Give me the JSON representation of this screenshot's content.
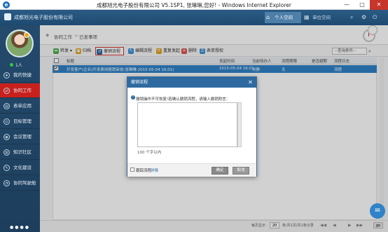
{
  "window": {
    "title": "成都旭光电子股份有限公司 V5.1SP1, 张琳琳,您好! - Windows Internet Explorer",
    "min": "—",
    "max": "□",
    "close": "✕"
  },
  "header": {
    "company": "成都旭光电子股份有限公司",
    "nav_personal": "个人空间",
    "nav_unit": "单位空间"
  },
  "sidebar": {
    "user_status": "1人",
    "items": [
      {
        "label": "我的快捷"
      },
      {
        "label": "协同工作"
      },
      {
        "label": "表单应用"
      },
      {
        "label": "目标管理"
      },
      {
        "label": "会议管理"
      },
      {
        "label": "知识社区"
      },
      {
        "label": "文化建设"
      },
      {
        "label": "协同驾驶舱"
      }
    ],
    "dots": "●●●●"
  },
  "breadcrumb": {
    "section": "协同工作",
    "separator": ">",
    "current": "已发事项"
  },
  "toolbar": {
    "transfer": "转发",
    "archive": "归档",
    "revoke_flow": "撤销流程",
    "edit_flow": "编辑流程",
    "resend": "重复发起",
    "delete": "删除",
    "form_auth": "表单授权",
    "filter_placeholder": "--查询条件--"
  },
  "table": {
    "headers": {
      "title": "标题",
      "sent_time": "发起时间",
      "current_handler": "当前待办人",
      "deadline": "流程期限",
      "overdue": "是否超期",
      "process_log": "流程日志"
    },
    "rows": [
      {
        "checked": "✔",
        "title": "开发客户(企业)开发费用报销审批(张琳琳 2015-05-04 16:01)",
        "sent_time": "2015-05-04 16:01",
        "current_handler": "刘静",
        "deadline": "无",
        "overdue": "",
        "process_log": "流程"
      }
    ]
  },
  "pager": {
    "per_page_label": "每页显示",
    "per_page": "20",
    "total": "条/共1页/共1条记录",
    "first": "◀◀",
    "prev": "◀",
    "next": "▶",
    "last": "▶▶",
    "go": "go"
  },
  "modal": {
    "title": "撤销流程",
    "close": "✕",
    "message": "撤销操作不可恢复!若确认撤销流程，请输入撤销附言：",
    "textarea_value": "",
    "char_limit": "100 个字以内",
    "trace_label": "跟踪流程",
    "trace_link": "详情",
    "ok": "确定",
    "cancel": "取消"
  },
  "colors": {
    "header": "#2b5b86",
    "sidebar": "#244a6c",
    "active_item": "#c8211d",
    "selected_row": "#2f82c7",
    "modal_title": "#2e6aa0"
  }
}
